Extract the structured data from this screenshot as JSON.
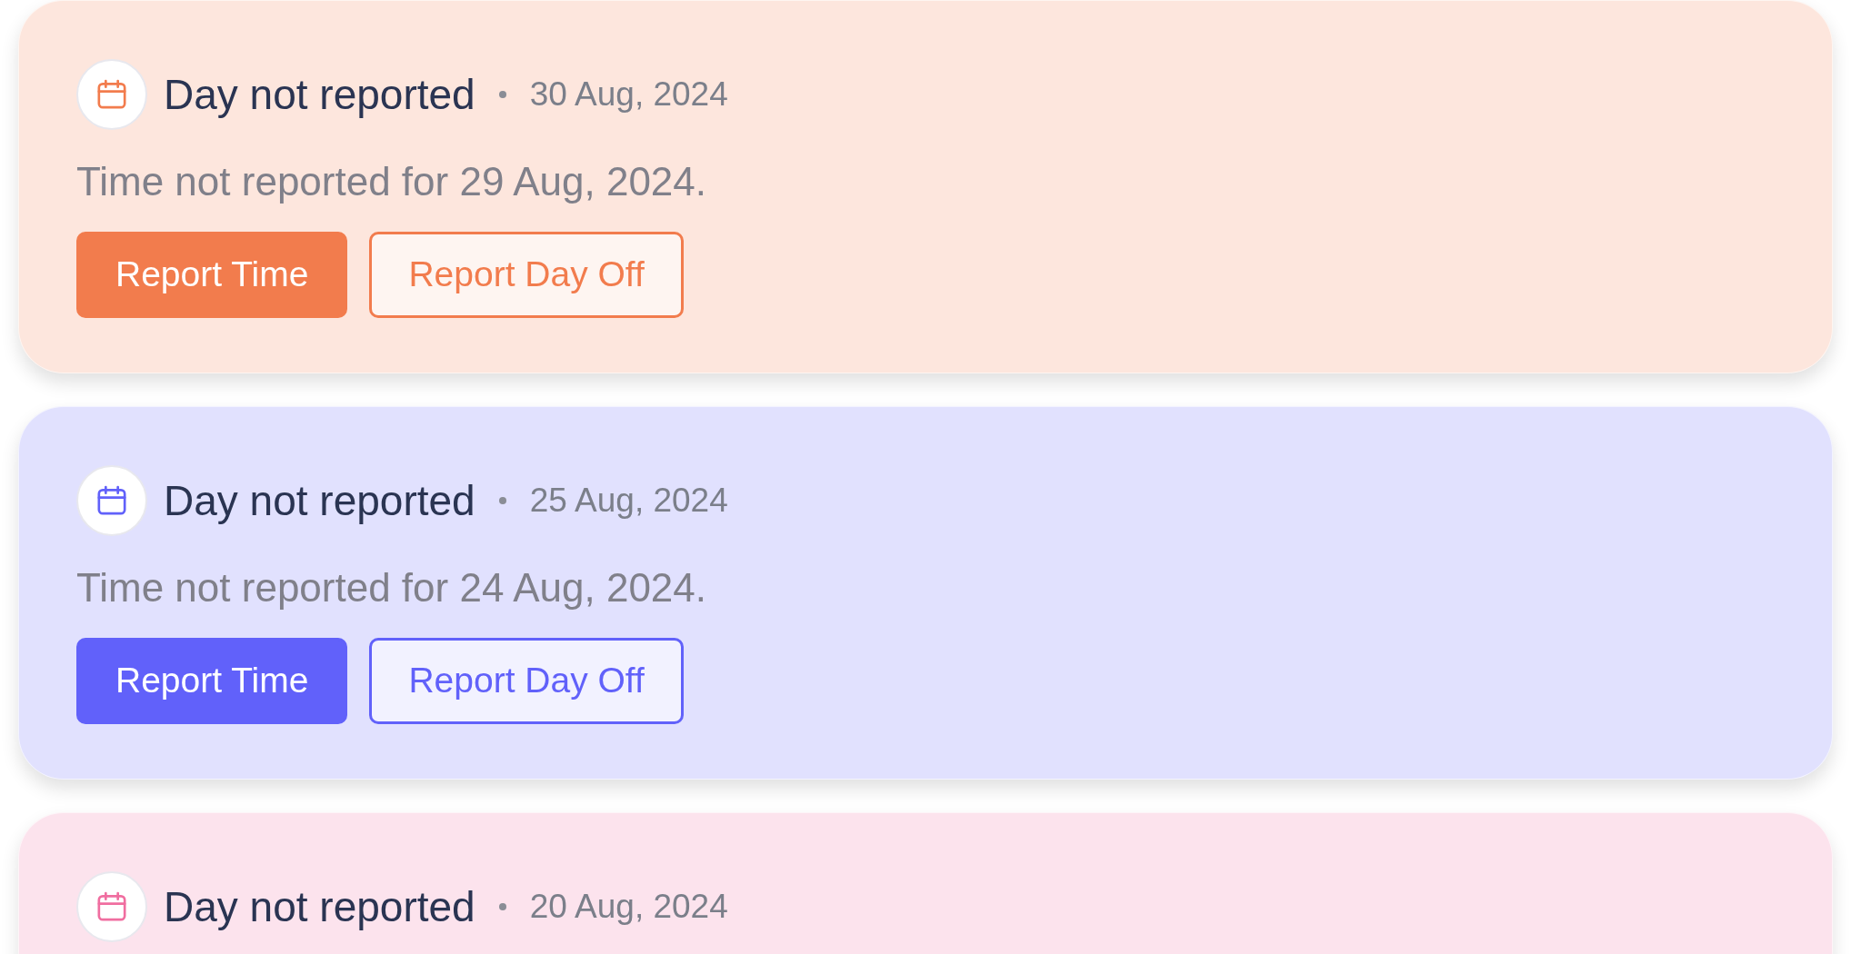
{
  "notifications": [
    {
      "title": "Day not reported",
      "date": "30 Aug, 2024",
      "color": "#f27c4d",
      "message": "Time not reported for 29 Aug, 2024.",
      "buttons": [
        {
          "label": "Report Time",
          "kind": "primary"
        },
        {
          "label": "Report Day Off",
          "kind": "secondary"
        }
      ]
    },
    {
      "title": "Day not reported",
      "date": "25 Aug, 2024",
      "color": "#6161fa",
      "message": "Time not reported for 24 Aug, 2024.",
      "buttons": [
        {
          "label": "Report Time",
          "kind": "primary"
        },
        {
          "label": "Report Day Off",
          "kind": "secondary"
        }
      ]
    },
    {
      "title": "Day not reported",
      "date": "20 Aug, 2024",
      "color": "#f06ea0"
    }
  ]
}
